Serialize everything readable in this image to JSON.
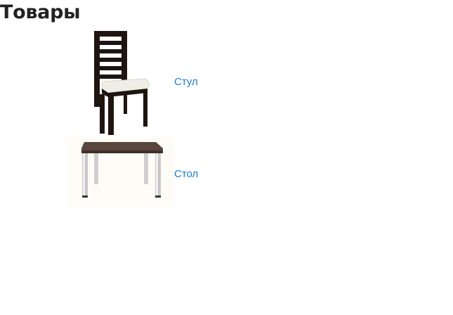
{
  "page": {
    "title": "Товары"
  },
  "products": [
    {
      "name": "Стул",
      "image_icon": "chair-image"
    },
    {
      "name": "Стол",
      "image_icon": "table-image"
    }
  ],
  "colors": {
    "link": "#1a7fd1",
    "title": "#222222",
    "chair_wood": "#1e1410",
    "chair_seat": "#efeee6",
    "table_top": "#5a463e",
    "table_legs": "#c8c8c8"
  }
}
